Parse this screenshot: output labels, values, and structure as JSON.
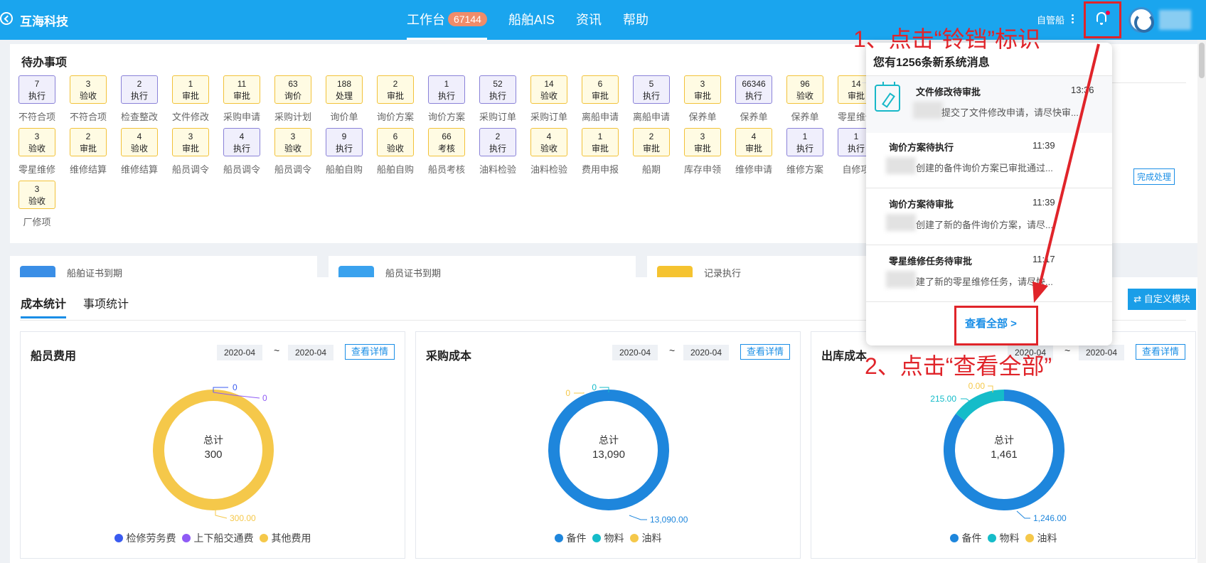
{
  "header": {
    "brand": "互海科技",
    "nav": [
      {
        "label": "工作台",
        "badge": "67144"
      },
      {
        "label": "船舶AIS"
      },
      {
        "label": "资讯"
      },
      {
        "label": "帮助"
      }
    ],
    "ship_selector": "自管船"
  },
  "todo": {
    "title": "待办事项",
    "items": [
      {
        "count": "7",
        "action": "执行",
        "label": "不符合项",
        "color": "purple"
      },
      {
        "count": "3",
        "action": "验收",
        "label": "不符合项",
        "color": "yellow"
      },
      {
        "count": "2",
        "action": "执行",
        "label": "检查整改",
        "color": "purple"
      },
      {
        "count": "1",
        "action": "审批",
        "label": "文件修改",
        "color": "yellow"
      },
      {
        "count": "11",
        "action": "审批",
        "label": "采购申请",
        "color": "yellow"
      },
      {
        "count": "63",
        "action": "询价",
        "label": "采购计划",
        "color": "yellow"
      },
      {
        "count": "188",
        "action": "处理",
        "label": "询价单",
        "color": "yellow"
      },
      {
        "count": "2",
        "action": "审批",
        "label": "询价方案",
        "color": "yellow"
      },
      {
        "count": "1",
        "action": "执行",
        "label": "询价方案",
        "color": "purple"
      },
      {
        "count": "52",
        "action": "执行",
        "label": "采购订单",
        "color": "purple"
      },
      {
        "count": "14",
        "action": "验收",
        "label": "采购订单",
        "color": "yellow"
      },
      {
        "count": "6",
        "action": "审批",
        "label": "离船申请",
        "color": "yellow"
      },
      {
        "count": "5",
        "action": "执行",
        "label": "离船申请",
        "color": "purple"
      },
      {
        "count": "3",
        "action": "审批",
        "label": "保养单",
        "color": "yellow"
      },
      {
        "count": "66346",
        "action": "执行",
        "label": "保养单",
        "color": "purple"
      },
      {
        "count": "96",
        "action": "验收",
        "label": "保养单",
        "color": "yellow"
      },
      {
        "count": "14",
        "action": "审批",
        "label": "零星维修",
        "color": "yellow"
      },
      {
        "count": "3",
        "action": "验收",
        "label": "零星维修",
        "color": "yellow"
      },
      {
        "count": "2",
        "action": "审批",
        "label": "维修结算",
        "color": "yellow"
      },
      {
        "count": "4",
        "action": "验收",
        "label": "维修结算",
        "color": "yellow"
      },
      {
        "count": "3",
        "action": "审批",
        "label": "船员调令",
        "color": "yellow"
      },
      {
        "count": "4",
        "action": "执行",
        "label": "船员调令",
        "color": "purple"
      },
      {
        "count": "3",
        "action": "验收",
        "label": "船员调令",
        "color": "yellow"
      },
      {
        "count": "9",
        "action": "执行",
        "label": "船舶自购",
        "color": "purple"
      },
      {
        "count": "6",
        "action": "验收",
        "label": "船舶自购",
        "color": "yellow"
      },
      {
        "count": "66",
        "action": "考核",
        "label": "船员考核",
        "color": "yellow"
      },
      {
        "count": "2",
        "action": "执行",
        "label": "油料检验",
        "color": "purple"
      },
      {
        "count": "4",
        "action": "验收",
        "label": "油料检验",
        "color": "yellow"
      },
      {
        "count": "1",
        "action": "审批",
        "label": "费用申报",
        "color": "yellow"
      },
      {
        "count": "2",
        "action": "审批",
        "label": "船期",
        "color": "yellow"
      },
      {
        "count": "3",
        "action": "审批",
        "label": "库存申领",
        "color": "yellow"
      },
      {
        "count": "4",
        "action": "审批",
        "label": "维修申请",
        "color": "yellow"
      },
      {
        "count": "1",
        "action": "执行",
        "label": "维修方案",
        "color": "purple"
      },
      {
        "count": "1",
        "action": "执行",
        "label": "自修项",
        "color": "purple"
      },
      {
        "count": "3",
        "action": "验收",
        "label": "厂修项",
        "color": "yellow"
      }
    ],
    "done_button": "完成处理"
  },
  "certs": [
    {
      "label": "船舶证书到期",
      "color": "#3a8ee6"
    },
    {
      "label": "船员证书到期",
      "color": "#3aa2ee"
    },
    {
      "label": "记录执行",
      "color": "#f5c330"
    }
  ],
  "stats": {
    "tabs": [
      "成本统计",
      "事项统计"
    ],
    "custom_button": "自定义模块",
    "cards": [
      {
        "title": "船员费用",
        "date_from": "2020-04",
        "tilde": "~",
        "date_to": "2020-04",
        "detail_button": "查看详情",
        "center_label": "总计",
        "center_value": "300",
        "slices": [
          {
            "name": "检修劳务费",
            "value": 0,
            "label": "0",
            "color": "#3a5bf0"
          },
          {
            "name": "上下船交通费",
            "value": 0,
            "label": "0",
            "color": "#8f5bf5"
          },
          {
            "name": "其他费用",
            "value": 300,
            "label": "300.00",
            "color": "#f5c84a"
          }
        ]
      },
      {
        "title": "采购成本",
        "date_from": "2020-04",
        "tilde": "~",
        "date_to": "2020-04",
        "detail_button": "查看详情",
        "center_label": "总计",
        "center_value": "13,090",
        "slices": [
          {
            "name": "备件",
            "value": 13090,
            "label": "13,090.00",
            "color": "#1e86dc"
          },
          {
            "name": "物料",
            "value": 0,
            "label": "0",
            "color": "#15bcc9"
          },
          {
            "name": "油料",
            "value": 0,
            "label": "0",
            "color": "#f5c84a"
          }
        ]
      },
      {
        "title": "出库成本",
        "date_from": "2020-04",
        "tilde": "~",
        "date_to": "2020-04",
        "detail_button": "查看详情",
        "center_label": "总计",
        "center_value": "1,461",
        "slices": [
          {
            "name": "备件",
            "value": 1246,
            "label": "1,246.00",
            "color": "#1e86dc"
          },
          {
            "name": "物料",
            "value": 215,
            "label": "215.00",
            "color": "#15bcc9"
          },
          {
            "name": "油料",
            "value": 0,
            "label": "0.00",
            "color": "#f5c84a"
          }
        ]
      }
    ]
  },
  "notifications": {
    "header": "您有1256条新系统消息",
    "items": [
      {
        "title": "文件修改待审批",
        "time": "13:36",
        "desc": "提交了文件修改申请，请尽快审..."
      },
      {
        "title": "询价方案待执行",
        "time": "11:39",
        "desc": "创建的备件询价方案已审批通过..."
      },
      {
        "title": "询价方案待审批",
        "time": "11:39",
        "desc": "创建了新的备件询价方案，请尽..."
      },
      {
        "title": "零星维修任务待审批",
        "time": "11:17",
        "desc": "建了新的零星维修任务，请尽快..."
      }
    ],
    "view_all": "查看全部 >"
  },
  "annotations": {
    "step1": "1、点击“铃铛”标识",
    "step2": "2、点击“查看全部”"
  },
  "colors": {
    "primary": "#1aa5ee",
    "accent": "#e0242a",
    "link": "#1a8ee6"
  }
}
